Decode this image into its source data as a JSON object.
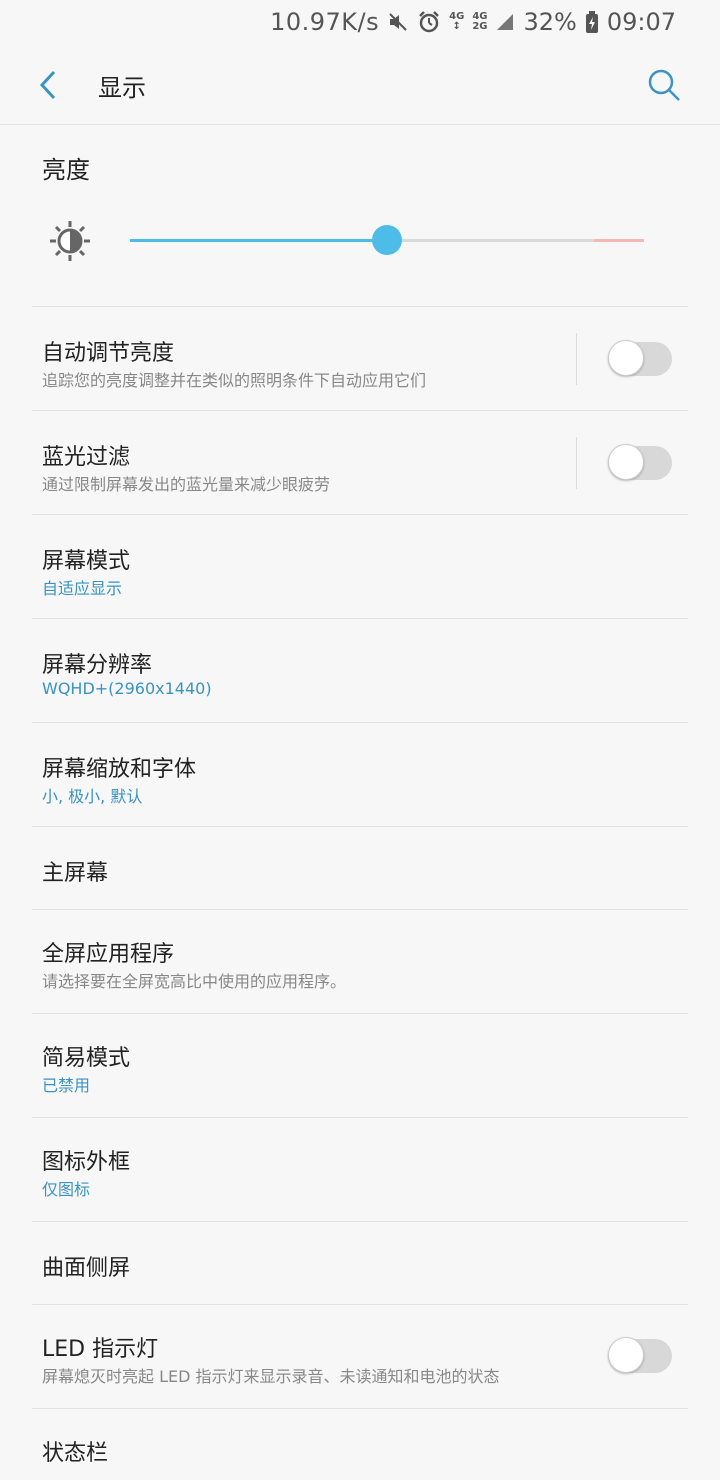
{
  "status_bar": {
    "net_speed": "10.97K/s",
    "battery": "32%",
    "time": "09:07",
    "icons": [
      "mute-icon",
      "alarm-icon",
      "4g-signal-icon",
      "4g-2g-signal-icon",
      "battery-charging-icon"
    ]
  },
  "appbar": {
    "title": "显示",
    "back_icon": "back-arrow-icon",
    "search_icon": "search-icon"
  },
  "brightness": {
    "title": "亮度",
    "level": 0.5
  },
  "items": [
    {
      "label": "自动调节亮度",
      "sub": "追踪您的亮度调整并在类似的照明条件下自动应用它们",
      "toggle": false
    },
    {
      "label": "蓝光过滤",
      "sub": "通过限制屏幕发出的蓝光量来减少眼疲劳",
      "toggle": false
    },
    {
      "label": "屏幕模式",
      "sub": "自适应显示"
    },
    {
      "label": "屏幕分辨率",
      "sub": "WQHD+(2960x1440)"
    },
    {
      "label": "屏幕缩放和字体",
      "sub": "小, 极小, 默认"
    },
    {
      "label": "主屏幕"
    },
    {
      "label": "全屏应用程序",
      "sub": "请选择要在全屏宽高比中使用的应用程序。"
    },
    {
      "label": "简易模式",
      "sub": "已禁用"
    },
    {
      "label": "图标外框",
      "sub": "仅图标"
    },
    {
      "label": "曲面侧屏"
    },
    {
      "label": "LED 指示灯",
      "sub": "屏幕熄灭时亮起 LED 指示灯来显示录音、未读通知和电池的状态",
      "toggle": false
    },
    {
      "label": "状态栏"
    }
  ],
  "colors": {
    "accent": "#4dbde8",
    "link": "#3a93c4",
    "background": "#f7f7f7"
  }
}
